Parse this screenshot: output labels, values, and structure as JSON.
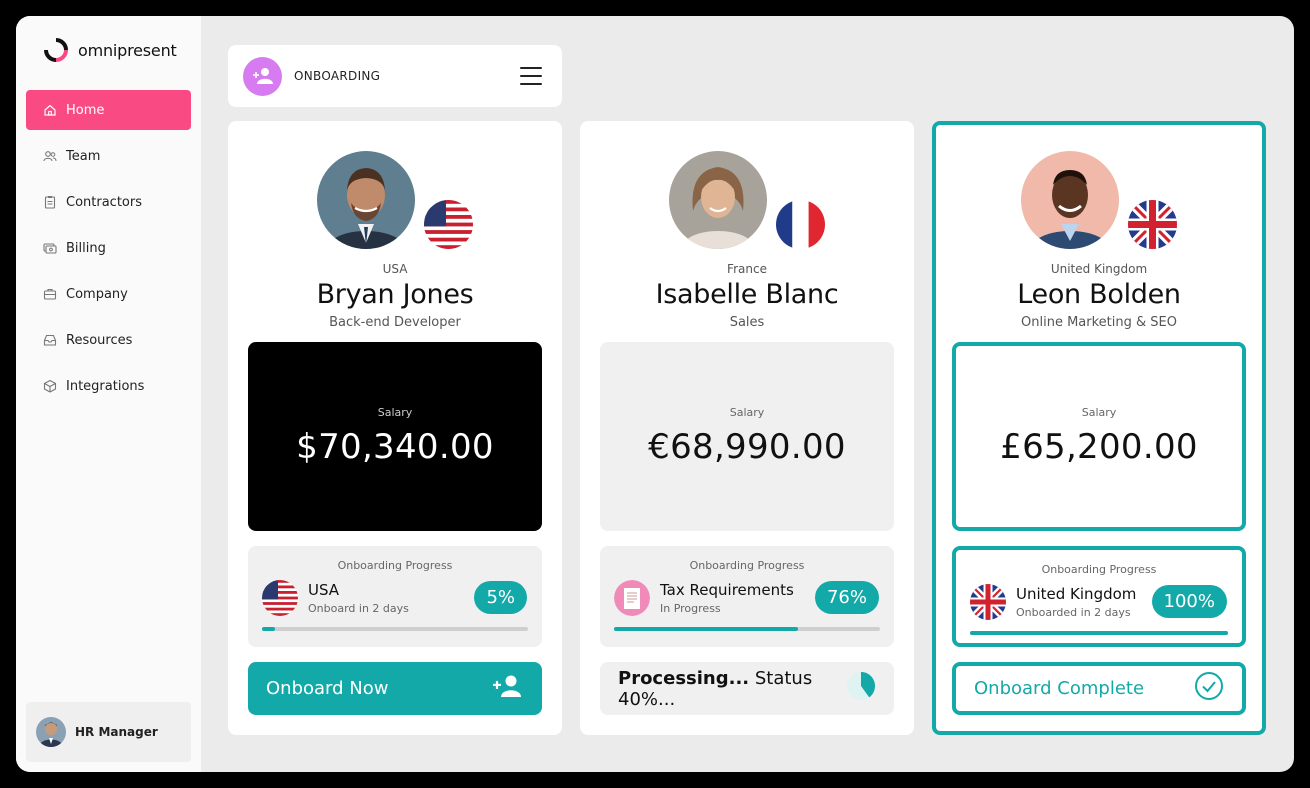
{
  "app": {
    "logo_text": "omnipresent"
  },
  "sidebar": {
    "items": [
      {
        "label": "Home",
        "icon": "home-icon",
        "active": true
      },
      {
        "label": "Team",
        "icon": "team-icon",
        "active": false
      },
      {
        "label": "Contractors",
        "icon": "clipboard-icon",
        "active": false
      },
      {
        "label": "Billing",
        "icon": "billing-icon",
        "active": false
      },
      {
        "label": "Company",
        "icon": "briefcase-icon",
        "active": false
      },
      {
        "label": "Resources",
        "icon": "inbox-icon",
        "active": false
      },
      {
        "label": "Integrations",
        "icon": "cube-icon",
        "active": false
      }
    ],
    "user": {
      "name": "HR Manager"
    }
  },
  "header": {
    "title": "ONBOARDING",
    "icon": "add-user-icon"
  },
  "colors": {
    "accent": "#14a9a9",
    "active_nav": "#fa4a84",
    "header_icon_bg": "#d67cf0"
  },
  "cards": [
    {
      "country": "USA",
      "name": "Bryan Jones",
      "role": "Back-end Developer",
      "salary_label": "Salary",
      "salary": "$70,340.00",
      "progress_title": "Onboarding Progress",
      "progress_main": "USA",
      "progress_sub": "Onboard in 2 days",
      "progress_pct_label": "5%",
      "progress_fraction": 0.05,
      "action_label": "Onboard Now"
    },
    {
      "country": "France",
      "name": "Isabelle Blanc",
      "role": "Sales",
      "salary_label": "Salary",
      "salary": "€68,990.00",
      "progress_title": "Onboarding Progress",
      "progress_main": "Tax Requirements",
      "progress_sub": "In Progress",
      "progress_pct_label": "76%",
      "progress_fraction": 0.69,
      "action_bold": "Processing...",
      "action_rest": " Status 40%...",
      "action_fraction": 0.4
    },
    {
      "country": "United Kingdom",
      "name": "Leon Bolden",
      "role": "Online Marketing & SEO",
      "salary_label": "Salary",
      "salary": "£65,200.00",
      "progress_title": "Onboarding Progress",
      "progress_main": "United Kingdom",
      "progress_sub": "Onboarded in 2 days",
      "progress_pct_label": "100%",
      "progress_fraction": 1.0,
      "action_label": "Onboard Complete"
    }
  ]
}
